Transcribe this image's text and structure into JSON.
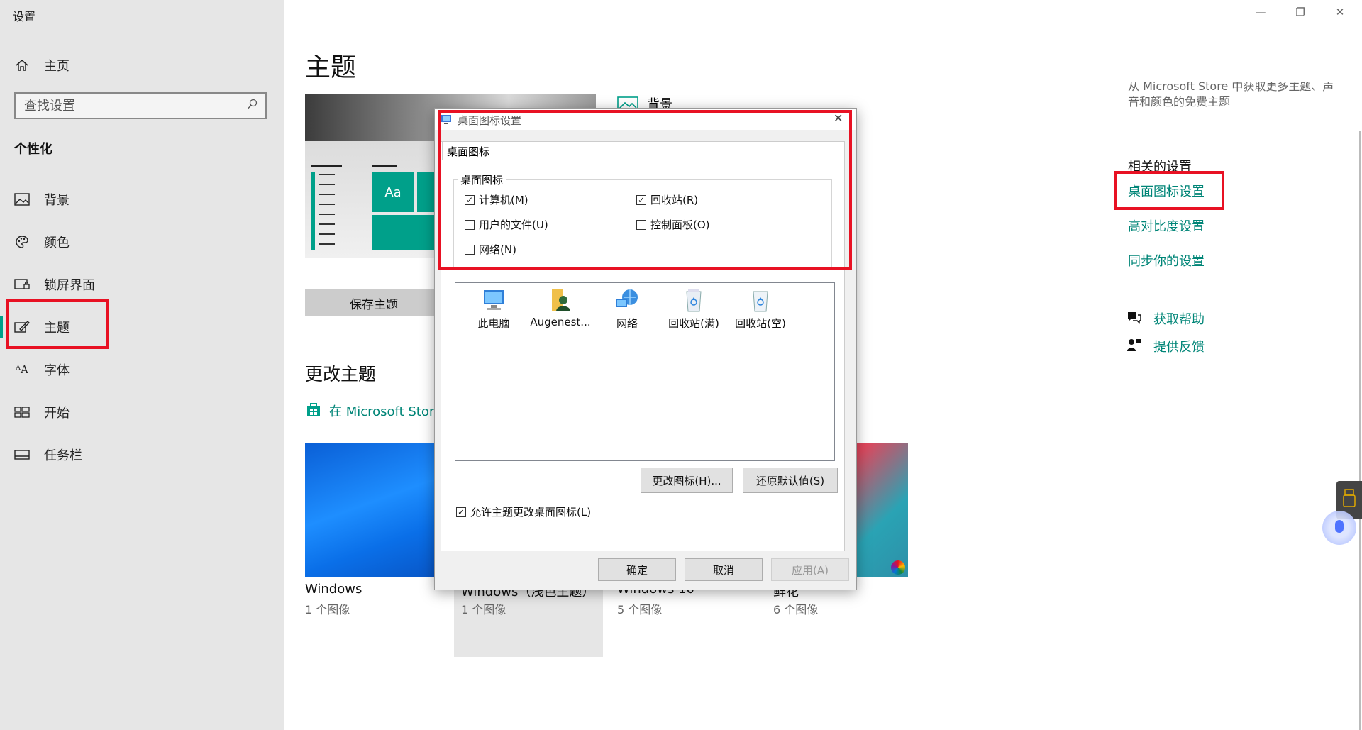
{
  "window": {
    "title": "设置",
    "minimize_icon": "minimize-icon",
    "restore_icon": "restore-icon",
    "close_icon": "close-icon"
  },
  "sidebar": {
    "home_label": "主页",
    "search_placeholder": "查找设置",
    "section_title": "个性化",
    "items": [
      {
        "label": "背景",
        "icon": "picture-icon"
      },
      {
        "label": "颜色",
        "icon": "palette-icon"
      },
      {
        "label": "锁屏界面",
        "icon": "lock-screen-icon"
      },
      {
        "label": "主题",
        "icon": "theme-icon",
        "selected": true
      },
      {
        "label": "字体",
        "icon": "font-icon"
      },
      {
        "label": "开始",
        "icon": "start-icon"
      },
      {
        "label": "任务栏",
        "icon": "taskbar-icon"
      }
    ]
  },
  "main": {
    "page_title": "主题",
    "preview_tile_text": "Aa",
    "save_theme_button": "保存主题",
    "background_label": "背景",
    "change_theme_title": "更改主题",
    "store_link": "在 Microsoft Store",
    "themes": [
      {
        "name": "Windows",
        "count": "1 个图像"
      },
      {
        "name": "Windows（浅色主题）",
        "count": "1 个图像"
      },
      {
        "name": "Windows 10",
        "count": "5 个图像"
      },
      {
        "name": "鲜花",
        "count": "6 个图像"
      }
    ]
  },
  "right_panel": {
    "store_text_1": "从 Microsoft Store 中获取更多主题、声",
    "store_text_2": "音和颜色的免费主题",
    "related_title": "相关的设置",
    "links": [
      "桌面图标设置",
      "高对比度设置",
      "同步你的设置"
    ],
    "help_link": "获取帮助",
    "feedback_link": "提供反馈"
  },
  "dialog": {
    "title": "桌面图标设置",
    "tab": "桌面图标",
    "group_title": "桌面图标",
    "checkboxes": [
      {
        "label": "计算机(M)",
        "checked": true
      },
      {
        "label": "回收站(R)",
        "checked": true
      },
      {
        "label": "用户的文件(U)",
        "checked": false
      },
      {
        "label": "控制面板(O)",
        "checked": false
      },
      {
        "label": "网络(N)",
        "checked": false
      }
    ],
    "icons": [
      "此电脑",
      "Augenest...",
      "网络",
      "回收站(满)",
      "回收站(空)"
    ],
    "change_icon_button": "更改图标(H)...",
    "restore_default_button": "还原默认值(S)",
    "allow_themes_label": "允许主题更改桌面图标(L)",
    "allow_themes_checked": true,
    "ok_button": "确定",
    "cancel_button": "取消",
    "apply_button": "应用(A)"
  }
}
